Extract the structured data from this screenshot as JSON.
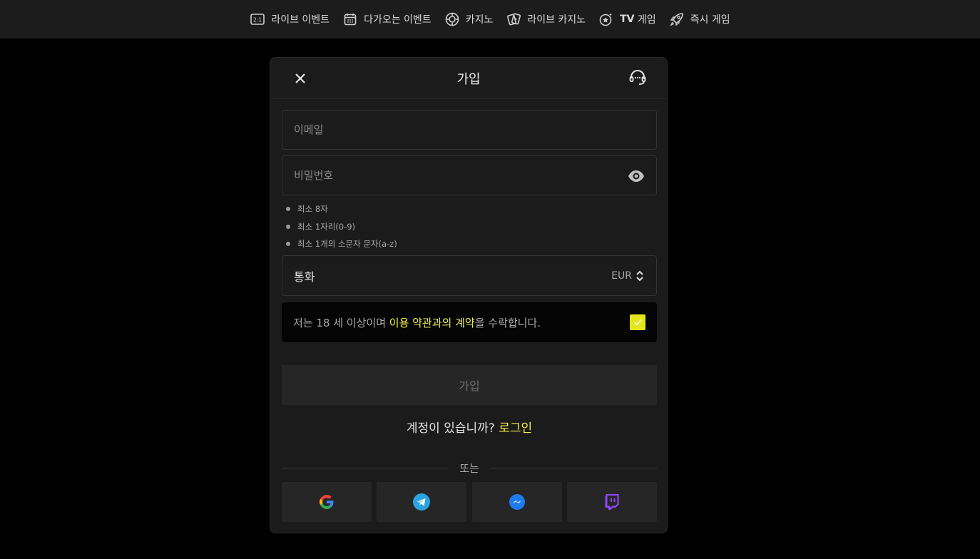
{
  "nav": {
    "items": [
      {
        "label": "라이브 이벤트",
        "icon": "live-scoreboard-icon"
      },
      {
        "label": "다가오는 이벤트",
        "icon": "calendar-icon"
      },
      {
        "label": "카지노",
        "icon": "casino-chip-icon"
      },
      {
        "label": "라이브 카지노",
        "icon": "playing-cards-icon"
      },
      {
        "label_bold": "TV",
        "label": " 게임",
        "icon": "tv-games-icon"
      },
      {
        "label": "즉시 게임",
        "icon": "rocket-icon"
      }
    ]
  },
  "modal": {
    "title": "가입",
    "email_placeholder": "이메일",
    "password_placeholder": "비밀번호",
    "password_rules": [
      "최소 8자",
      "최소 1자리(0-9)",
      "최소 1개의 소문자 문자(a-z)"
    ],
    "currency_label": "통화",
    "currency_value": "EUR",
    "terms_prefix": "저는 18 세 이상이며 ",
    "terms_link": "이용 약관과의 계약",
    "terms_suffix": "을 수락합니다.",
    "terms_checked": true,
    "submit_label": "가입",
    "login_prompt": "계정이 있습니까? ",
    "login_link": "로그인",
    "divider_text": "또는",
    "social_providers": [
      "google-icon",
      "telegram-icon",
      "messenger-icon",
      "twitch-icon"
    ]
  },
  "colors": {
    "accent": "#f0f04a",
    "checkbox": "#e5e619",
    "background": "#000000",
    "panel": "#1b1b1b"
  }
}
